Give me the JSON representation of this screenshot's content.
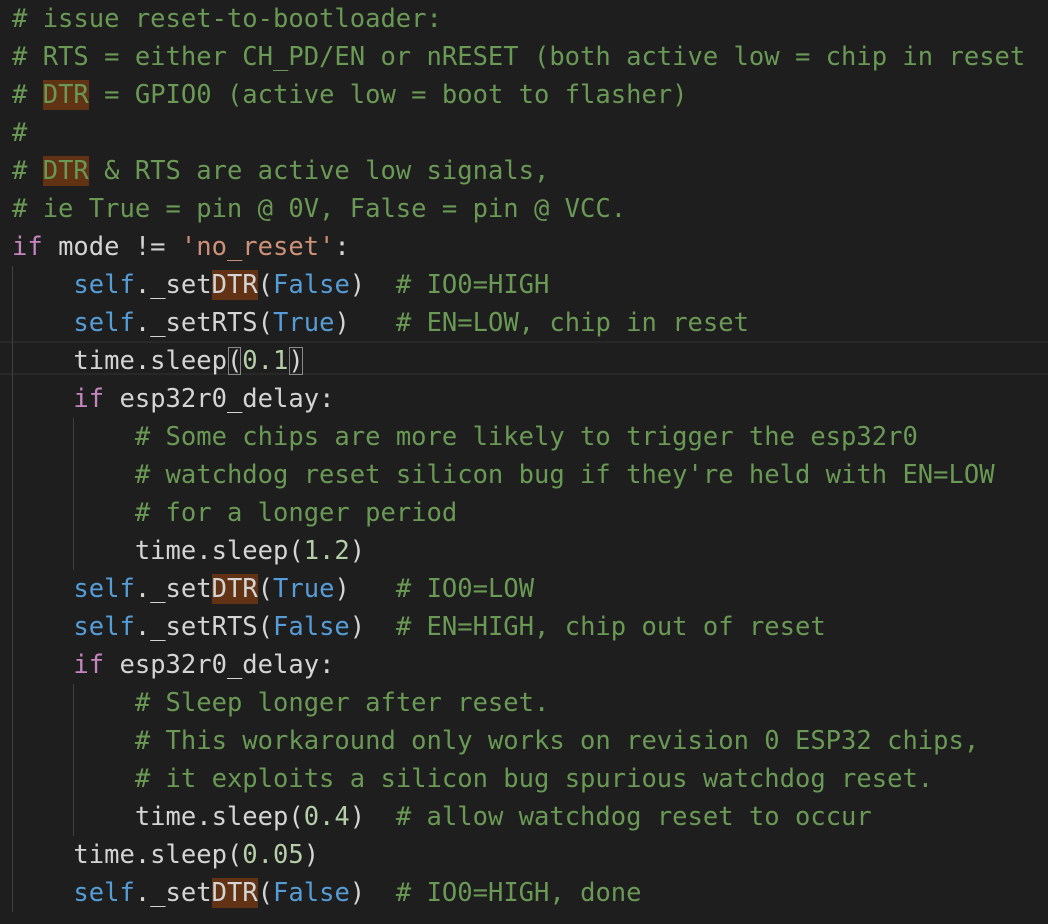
{
  "editor": {
    "lines": [
      {
        "id": 1,
        "segments": [
          {
            "t": "cm",
            "v": "# issue reset-to-bootloader:"
          }
        ]
      },
      {
        "id": 2,
        "segments": [
          {
            "t": "cm",
            "v": "# RTS = either CH_PD/EN or nRESET (both active low = chip in reset"
          }
        ]
      },
      {
        "id": 3,
        "segments": [
          {
            "t": "cm",
            "v": "# "
          },
          {
            "t": "cm hl",
            "v": "DTR"
          },
          {
            "t": "cm",
            "v": " = GPIO0 (active low = boot to flasher)"
          }
        ]
      },
      {
        "id": 4,
        "segments": [
          {
            "t": "cm",
            "v": "#"
          }
        ]
      },
      {
        "id": 5,
        "segments": [
          {
            "t": "cm",
            "v": "# "
          },
          {
            "t": "cm hl",
            "v": "DTR"
          },
          {
            "t": "cm",
            "v": " & RTS are active low signals,"
          }
        ]
      },
      {
        "id": 6,
        "segments": [
          {
            "t": "cm",
            "v": "# ie True = pin @ 0V, False = pin @ VCC."
          }
        ]
      },
      {
        "id": 7,
        "segments": [
          {
            "t": "kw",
            "v": "if"
          },
          {
            "t": "plain",
            "v": " mode != "
          },
          {
            "t": "str",
            "v": "'no_reset'"
          },
          {
            "t": "plain",
            "v": ":"
          }
        ]
      },
      {
        "id": 8,
        "segments": [
          {
            "t": "plain",
            "v": "    "
          },
          {
            "t": "self",
            "v": "self"
          },
          {
            "t": "plain",
            "v": "._set"
          },
          {
            "t": "plain hl",
            "v": "DTR"
          },
          {
            "t": "plain",
            "v": "("
          },
          {
            "t": "const",
            "v": "False"
          },
          {
            "t": "plain",
            "v": ")  "
          },
          {
            "t": "cm",
            "v": "# IO0=HIGH"
          }
        ]
      },
      {
        "id": 9,
        "segments": [
          {
            "t": "plain",
            "v": "    "
          },
          {
            "t": "self",
            "v": "self"
          },
          {
            "t": "plain",
            "v": "._setRTS("
          },
          {
            "t": "const",
            "v": "True"
          },
          {
            "t": "plain",
            "v": ")   "
          },
          {
            "t": "cm",
            "v": "# EN=LOW, chip in reset"
          }
        ]
      },
      {
        "id": 10,
        "segments": [
          {
            "t": "plain",
            "v": "    time.sleep"
          },
          {
            "t": "plain bracket",
            "v": "("
          },
          {
            "t": "num",
            "v": "0.1"
          },
          {
            "t": "plain bracket",
            "v": ")"
          }
        ]
      },
      {
        "id": 11,
        "segments": [
          {
            "t": "plain",
            "v": "    "
          },
          {
            "t": "kw",
            "v": "if"
          },
          {
            "t": "plain",
            "v": " esp32r0_delay:"
          }
        ]
      },
      {
        "id": 12,
        "segments": [
          {
            "t": "plain",
            "v": "        "
          },
          {
            "t": "cm",
            "v": "# Some chips are more likely to trigger the esp32r0"
          }
        ]
      },
      {
        "id": 13,
        "segments": [
          {
            "t": "plain",
            "v": "        "
          },
          {
            "t": "cm",
            "v": "# watchdog reset silicon bug if they're held with EN=LOW"
          }
        ]
      },
      {
        "id": 14,
        "segments": [
          {
            "t": "plain",
            "v": "        "
          },
          {
            "t": "cm",
            "v": "# for a longer period"
          }
        ]
      },
      {
        "id": 15,
        "segments": [
          {
            "t": "plain",
            "v": "        time.sleep("
          },
          {
            "t": "num",
            "v": "1.2"
          },
          {
            "t": "plain",
            "v": ")"
          }
        ]
      },
      {
        "id": 16,
        "segments": [
          {
            "t": "plain",
            "v": "    "
          },
          {
            "t": "self",
            "v": "self"
          },
          {
            "t": "plain",
            "v": "._set"
          },
          {
            "t": "plain hl",
            "v": "DTR"
          },
          {
            "t": "plain",
            "v": "("
          },
          {
            "t": "const",
            "v": "True"
          },
          {
            "t": "plain",
            "v": ")   "
          },
          {
            "t": "cm",
            "v": "# IO0=LOW"
          }
        ]
      },
      {
        "id": 17,
        "segments": [
          {
            "t": "plain",
            "v": "    "
          },
          {
            "t": "self",
            "v": "self"
          },
          {
            "t": "plain",
            "v": "._setRTS("
          },
          {
            "t": "const",
            "v": "False"
          },
          {
            "t": "plain",
            "v": ")  "
          },
          {
            "t": "cm",
            "v": "# EN=HIGH, chip out of reset"
          }
        ]
      },
      {
        "id": 18,
        "segments": [
          {
            "t": "plain",
            "v": "    "
          },
          {
            "t": "kw",
            "v": "if"
          },
          {
            "t": "plain",
            "v": " esp32r0_delay:"
          }
        ]
      },
      {
        "id": 19,
        "segments": [
          {
            "t": "plain",
            "v": "        "
          },
          {
            "t": "cm",
            "v": "# Sleep longer after reset."
          }
        ]
      },
      {
        "id": 20,
        "segments": [
          {
            "t": "plain",
            "v": "        "
          },
          {
            "t": "cm",
            "v": "# This workaround only works on revision 0 ESP32 chips,"
          }
        ]
      },
      {
        "id": 21,
        "segments": [
          {
            "t": "plain",
            "v": "        "
          },
          {
            "t": "cm",
            "v": "# it exploits a silicon bug spurious watchdog reset."
          }
        ]
      },
      {
        "id": 22,
        "segments": [
          {
            "t": "plain",
            "v": "        time.sleep("
          },
          {
            "t": "num",
            "v": "0.4"
          },
          {
            "t": "plain",
            "v": ")  "
          },
          {
            "t": "cm",
            "v": "# allow watchdog reset to occur"
          }
        ]
      },
      {
        "id": 23,
        "segments": [
          {
            "t": "plain",
            "v": "    time.sleep("
          },
          {
            "t": "num",
            "v": "0.05"
          },
          {
            "t": "plain",
            "v": ")"
          }
        ]
      },
      {
        "id": 24,
        "segments": [
          {
            "t": "plain",
            "v": "    "
          },
          {
            "t": "self",
            "v": "self"
          },
          {
            "t": "plain",
            "v": "._set"
          },
          {
            "t": "plain hl",
            "v": "DTR"
          },
          {
            "t": "plain",
            "v": "("
          },
          {
            "t": "const",
            "v": "False"
          },
          {
            "t": "plain",
            "v": ")  "
          },
          {
            "t": "cm",
            "v": "# IO0=HIGH, done"
          }
        ]
      }
    ]
  }
}
